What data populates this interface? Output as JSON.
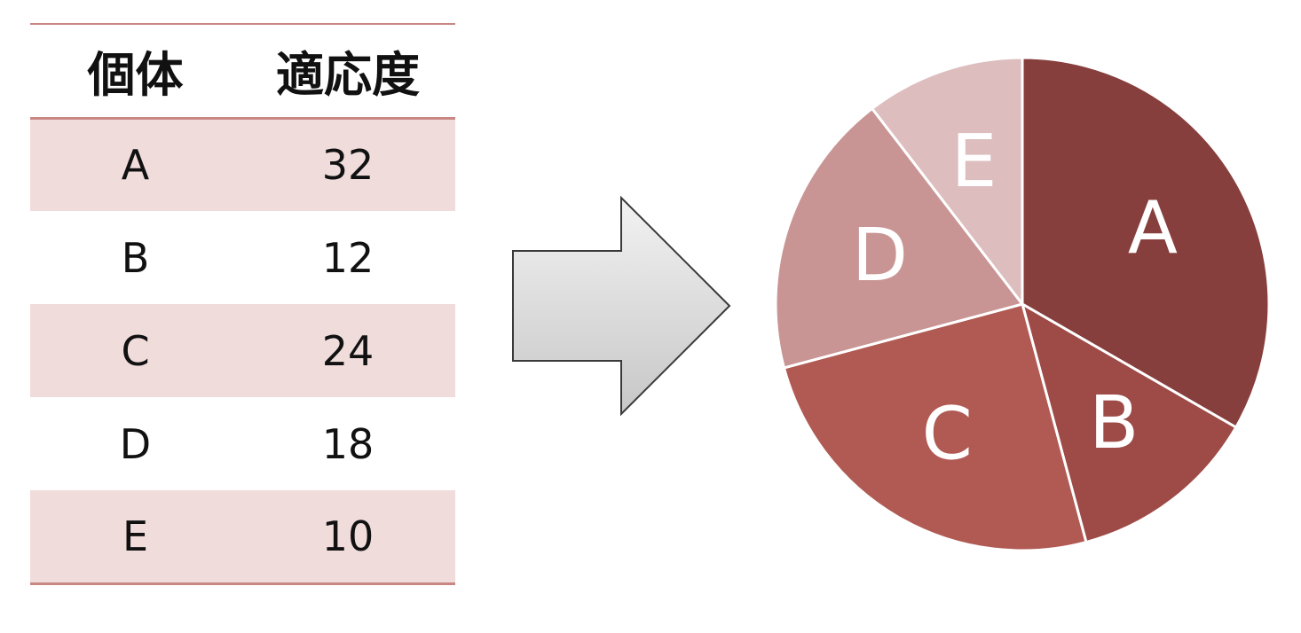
{
  "table": {
    "headers": [
      "個体",
      "適応度"
    ],
    "rows": [
      {
        "name": "A",
        "fitness": "32"
      },
      {
        "name": "B",
        "fitness": "12"
      },
      {
        "name": "C",
        "fitness": "24"
      },
      {
        "name": "D",
        "fitness": "18"
      },
      {
        "name": "E",
        "fitness": "10"
      }
    ]
  },
  "colors": {
    "header_rule": "#c98783",
    "shaded_row": "#f1dcdc",
    "arrow_top": "#f2f2f2",
    "arrow_bottom": "#c7c7c7",
    "arrow_stroke": "#3a3a3a",
    "slice_separator": "#ffffff"
  },
  "chart_data": {
    "type": "pie",
    "categories": [
      "A",
      "B",
      "C",
      "D",
      "E"
    ],
    "values": [
      32,
      12,
      24,
      18,
      10
    ],
    "colors": [
      "#873f3d",
      "#9e4b47",
      "#b05a53",
      "#c89594",
      "#ddbdbd"
    ],
    "start": "12 o'clock",
    "direction": "clockwise",
    "legend": "none",
    "labels": "inside slices"
  }
}
